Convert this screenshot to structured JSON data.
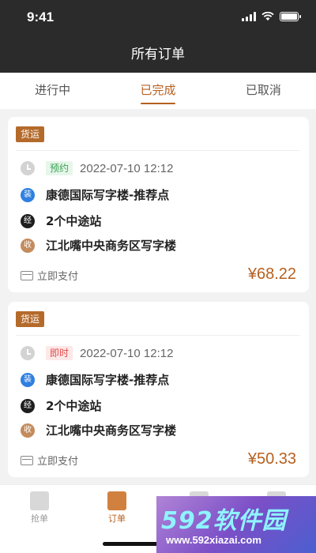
{
  "status_bar": {
    "time": "9:41"
  },
  "nav": {
    "title": "所有订单"
  },
  "tabs": [
    {
      "label": "进行中"
    },
    {
      "label": "已完成",
      "active": true
    },
    {
      "label": "已取消"
    }
  ],
  "orders": [
    {
      "type": "货运",
      "badge": "预约",
      "badge_color": "green",
      "time": "2022-07-10 12:12",
      "stops": [
        {
          "marker": "装",
          "text": "康德国际写字楼-推荐点"
        },
        {
          "marker": "经",
          "text": "2个中途站"
        },
        {
          "marker": "收",
          "text": "江北嘴中央商务区写字楼"
        }
      ],
      "pay_label": "立即支付",
      "price": "¥68.22"
    },
    {
      "type": "货运",
      "badge": "即时",
      "badge_color": "red",
      "time": "2022-07-10 12:12",
      "stops": [
        {
          "marker": "装",
          "text": "康德国际写字楼-推荐点"
        },
        {
          "marker": "经",
          "text": "2个中途站"
        },
        {
          "marker": "收",
          "text": "江北嘴中央商务区写字楼"
        }
      ],
      "pay_label": "立即支付",
      "price": "¥50.33"
    }
  ],
  "tabbar": [
    {
      "label": "抢单",
      "icon": "grab-order-icon"
    },
    {
      "label": "订单",
      "icon": "orders-icon",
      "active": true
    },
    {
      "label": "",
      "icon": "message-icon"
    },
    {
      "label": "",
      "icon": "profile-icon"
    }
  ],
  "watermark": {
    "brand": "592软件园",
    "url": "www.592xiazai.com"
  },
  "colors": {
    "accent": "#b6601f",
    "header": "#2b2b2b",
    "tag": "#b46a2a"
  }
}
